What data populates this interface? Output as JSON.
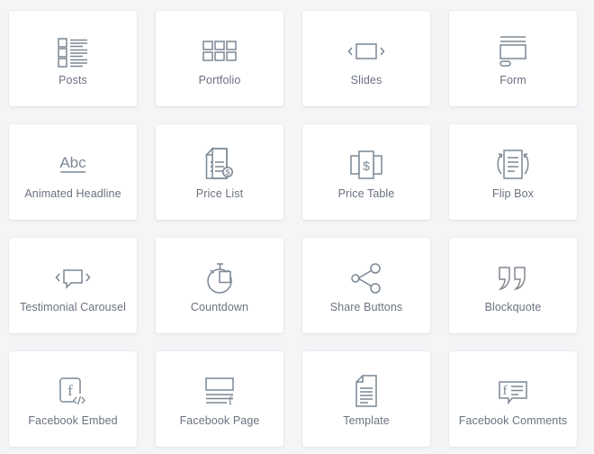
{
  "panel": {
    "background_color": "#f4f5f7",
    "card_color": "#ffffff",
    "icon_color": "#7b8794",
    "label_color": "#6b7280",
    "columns": 4,
    "rows": 4,
    "total_widgets": 16
  },
  "widgets": [
    {
      "label": "Posts",
      "icon": "posts-list-icon"
    },
    {
      "label": "Portfolio",
      "icon": "portfolio-grid-icon"
    },
    {
      "label": "Slides",
      "icon": "slides-carousel-icon"
    },
    {
      "label": "Form",
      "icon": "form-icon"
    },
    {
      "label": "Animated Headline",
      "icon": "animated-headline-abc-icon"
    },
    {
      "label": "Price List",
      "icon": "price-list-document-icon"
    },
    {
      "label": "Price Table",
      "icon": "price-table-columns-icon"
    },
    {
      "label": "Flip Box",
      "icon": "flip-box-icon"
    },
    {
      "label": "Testimonial Carousel",
      "icon": "testimonial-carousel-speech-icon"
    },
    {
      "label": "Countdown",
      "icon": "countdown-stopwatch-icon"
    },
    {
      "label": "Share Buttons",
      "icon": "share-nodes-icon"
    },
    {
      "label": "Blockquote",
      "icon": "blockquote-quotes-icon"
    },
    {
      "label": "Facebook Embed",
      "icon": "facebook-embed-code-icon"
    },
    {
      "label": "Facebook Page",
      "icon": "facebook-page-icon"
    },
    {
      "label": "Template",
      "icon": "template-document-icon"
    },
    {
      "label": "Facebook Comments",
      "icon": "facebook-comments-bubble-icon"
    }
  ]
}
